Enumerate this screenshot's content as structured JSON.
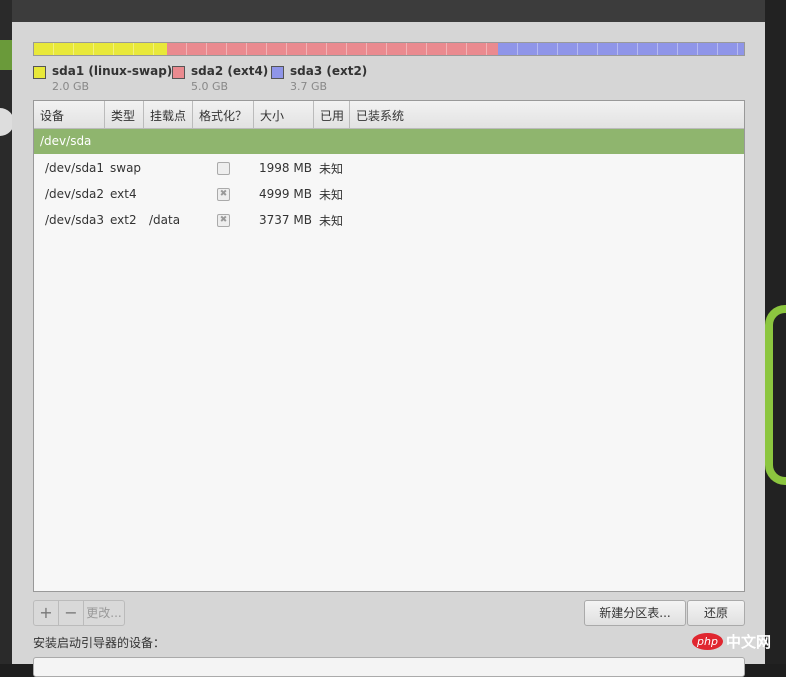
{
  "partitions": [
    {
      "name": "sda1 (linux-swap)",
      "size": "2.0 GB",
      "color": "#e8e83a",
      "fraction": 0.187
    },
    {
      "name": "sda2 (ext4)",
      "size": "5.0 GB",
      "color": "#ea8a8f",
      "fraction": 0.466
    },
    {
      "name": "sda3 (ext2)",
      "size": "3.7 GB",
      "color": "#8f95e8",
      "fraction": 0.347
    }
  ],
  "table": {
    "headers": [
      "设备",
      "类型",
      "挂载点",
      "格式化？",
      "大小",
      "已用",
      "已装系统"
    ],
    "group": "/dev/sda",
    "rows": [
      {
        "device": "/dev/sda1",
        "type": "swap",
        "mount": "",
        "format": false,
        "size": "1998 MB",
        "used": "未知"
      },
      {
        "device": "/dev/sda2",
        "type": "ext4",
        "mount": "",
        "format": true,
        "size": "4999 MB",
        "used": "未知"
      },
      {
        "device": "/dev/sda3",
        "type": "ext2",
        "mount": "/data",
        "format": true,
        "size": "3737 MB",
        "used": "未知"
      }
    ]
  },
  "buttons": {
    "add": "+",
    "remove": "−",
    "change": "更改...",
    "new_table": "新建分区表...",
    "revert": "还原"
  },
  "bootloader_label": "安装启动引导器的设备：",
  "watermark": {
    "php": "php",
    "cn": "中文网"
  }
}
